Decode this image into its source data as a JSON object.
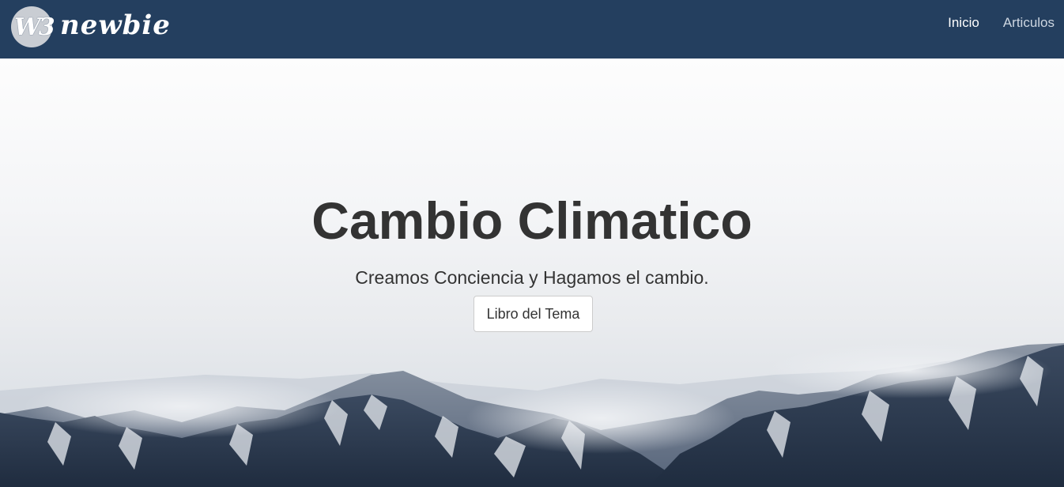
{
  "navbar": {
    "logo_mark": "W3",
    "brand_name": "newbie",
    "links": [
      {
        "label": "Inicio",
        "active": true
      },
      {
        "label": "Articulos",
        "active": false
      }
    ],
    "background_color": "#243f5f"
  },
  "hero": {
    "title": "Cambio Climatico",
    "subtitle": "Creamos Conciencia y Hagamos el cambio.",
    "button_label": "Libro del Tema",
    "background": "snowy-mountains-under-fog"
  }
}
